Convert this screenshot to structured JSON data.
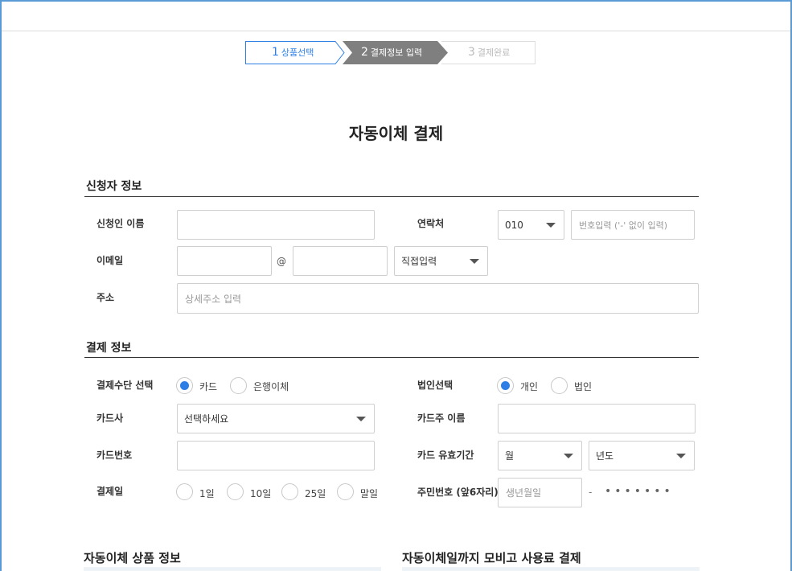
{
  "steps": [
    {
      "num": "1",
      "label": "상품선택"
    },
    {
      "num": "2",
      "label": "결제정보 입력"
    },
    {
      "num": "3",
      "label": "결제완료"
    }
  ],
  "page_title": "자동이체 결제",
  "applicant": {
    "section_title": "신청자 정보",
    "name_label": "신청인 이름",
    "name_value": "",
    "contact_label": "연락처",
    "phone_prefix": "010",
    "phone_placeholder": "번호입력 ('-' 없이 입력)",
    "email_label": "이메일",
    "email_at": "@",
    "email_domain_select": "직접입력",
    "address_label": "주소",
    "address_placeholder": "상세주소 입력"
  },
  "payment": {
    "section_title": "결제 정보",
    "method_label": "결제수단 선택",
    "method_options": [
      "카드",
      "은행이체"
    ],
    "method_selected": "카드",
    "corp_label": "법인선택",
    "corp_options": [
      "개인",
      "법인"
    ],
    "corp_selected": "개인",
    "card_company_label": "카드사",
    "card_company_select": "선택하세요",
    "card_owner_label": "카드주 이름",
    "card_number_label": "카드번호",
    "card_expiry_label": "카드 유효기간",
    "expiry_month_select": "월",
    "expiry_year_select": "년도",
    "pay_day_label": "결제일",
    "pay_day_options": [
      "1일",
      "10일",
      "25일",
      "말일"
    ],
    "resident_label": "주민번호 (앞6자리)",
    "resident_placeholder": "생년월일",
    "resident_dash": "-",
    "resident_mask": "•••••••"
  },
  "bottom": {
    "left_title": "자동이체 상품 정보",
    "right_title": "자동이체일까지 모비고 사용료 결제"
  },
  "colors": {
    "accent": "#2d7fe6",
    "frame": "#5b9bd5",
    "step_active": "#7f7f7f"
  }
}
